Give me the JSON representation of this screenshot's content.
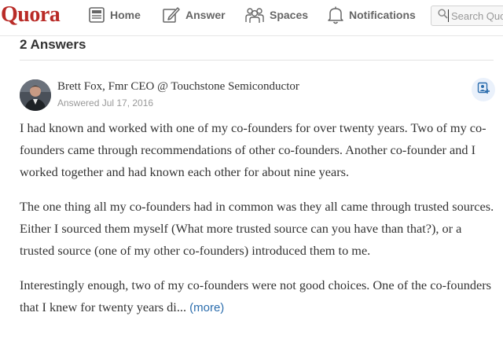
{
  "header": {
    "logo": "Quora",
    "nav": [
      {
        "label": "Home",
        "icon": "home-icon"
      },
      {
        "label": "Answer",
        "icon": "pencil-icon"
      },
      {
        "label": "Spaces",
        "icon": "people-icon"
      },
      {
        "label": "Notifications",
        "icon": "bell-icon"
      }
    ],
    "search_placeholder": "Search Quora"
  },
  "answers_count": "2 Answers",
  "answer": {
    "author": "Brett Fox, Fmr CEO @ Touchstone Semiconductor",
    "date": "Answered Jul 17, 2016",
    "paragraphs": [
      "I had known and worked with one of my co-founders for over twenty years. Two of my co-founders came through recommendations of other co-founders. Another co-founder and I worked together and had known each other for about nine years.",
      "The one thing all my co-founders had in common was they all came through trusted sources. Either I sourced them myself (What more trusted source can you have than that?), or a trusted source (one of my other co-founders) introduced them to me.",
      "Interestingly enough, two of my co-founders were not good choices. One of the co-founders that I knew for twenty years di..."
    ],
    "more_label": "(more)"
  },
  "colors": {
    "brand": "#b92b27",
    "link": "#2b6dad",
    "nav_text": "#666666"
  }
}
